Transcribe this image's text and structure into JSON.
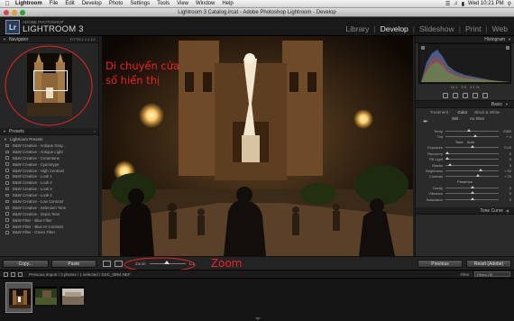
{
  "menubar": {
    "app_name": "Lightroom",
    "items": [
      "File",
      "Edit",
      "Develop",
      "Photo",
      "Settings",
      "Tools",
      "View",
      "Window",
      "Help"
    ],
    "clock": "Wed 10:21 PM"
  },
  "window": {
    "title": "Lightroom 3 Catalog.lrcat - Adobe Photoshop Lightroom - Develop"
  },
  "header": {
    "brand_top": "ADOBE PHOTOSHOP",
    "brand": "LIGHTROOM 3",
    "modules": [
      {
        "label": "Library",
        "active": false
      },
      {
        "label": "Develop",
        "active": true
      },
      {
        "label": "Slideshow",
        "active": false
      },
      {
        "label": "Print",
        "active": false
      },
      {
        "label": "Web",
        "active": false
      }
    ]
  },
  "navigator": {
    "title": "Navigator",
    "options": "FIT  FILL  1:1  3:1"
  },
  "presets": {
    "title": "Presets",
    "folder": "Lightroom Presets",
    "items": [
      "B&W Creative - Antique Gray...",
      "B&W Creative - Antique Light",
      "B&W Creative - Creamtone",
      "B&W Creative - Cyanotype",
      "B&W Creative - High Contrast",
      "B&W Creative - Look 1",
      "B&W Creative - Look 2",
      "B&W Creative - Look 3",
      "B&W Creative - Look 4",
      "B&W Creative - Low Contrast",
      "B&W Creative - Selenium Tone",
      "B&W Creative - Sepia Tone",
      "B&W Filter - Blue Filter",
      "B&W Filter - Blue Hi-Contrast",
      "B&W Filter - Green Filter"
    ]
  },
  "left_buttons": {
    "copy": "Copy...",
    "paste": "Paste"
  },
  "annotations": {
    "navigator_line1": "Di chuyển cửa",
    "navigator_line2": "sổ hiển thị",
    "zoom": "Zoom"
  },
  "toolbar": {
    "zoom_label": "Zoom",
    "zoom_value": "1:1"
  },
  "histogram": {
    "title": "Histogram",
    "info": [
      "15.1",
      "3.9",
      "4.1 %"
    ]
  },
  "basic": {
    "title": "Basic",
    "treatment_label": "Treatment :",
    "color": "Color",
    "bw": "Black & White",
    "wb_label": "WB :",
    "wb_value": "As Shot",
    "sliders": [
      {
        "label": "Temp",
        "value": "2950"
      },
      {
        "label": "Tint",
        "value": "+ 4"
      },
      {
        "label": "Tone",
        "value": "Auto"
      },
      {
        "label": "Exposure",
        "value": "0.00"
      },
      {
        "label": "Recovery",
        "value": "0"
      },
      {
        "label": "Fill Light",
        "value": "0"
      },
      {
        "label": "Blacks",
        "value": "5"
      },
      {
        "label": "Brightness",
        "value": "+ 50"
      },
      {
        "label": "Contrast",
        "value": "+ 25"
      },
      {
        "label": "Presence",
        "value": ""
      },
      {
        "label": "Clarity",
        "value": "0"
      },
      {
        "label": "Vibrance",
        "value": "0"
      },
      {
        "label": "Saturation",
        "value": "0"
      }
    ]
  },
  "tone_curve": {
    "title": "Tone Curve"
  },
  "right_buttons": {
    "previous": "Previous",
    "reset": "Reset (Adobe)"
  },
  "filmstrip_header": {
    "source": "Previous Import / 3 photos / 1 selected / DSC_0894.NEF",
    "filter_label": "Filter :",
    "filter_value": "Filters Off"
  }
}
